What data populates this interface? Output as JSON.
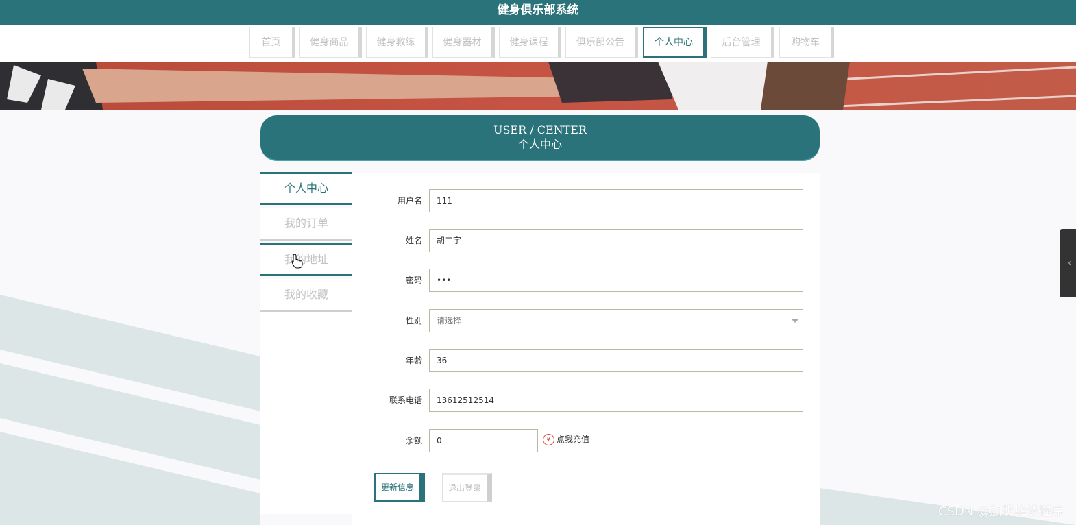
{
  "app": {
    "title": "健身俱乐部系统"
  },
  "nav": {
    "items": [
      "首页",
      "健身商品",
      "健身教练",
      "健身器材",
      "健身课程",
      "俱乐部公告",
      "个人中心",
      "后台管理",
      "购物车"
    ],
    "active_index": 6
  },
  "header": {
    "en": "USER / CENTER",
    "cn": "个人中心"
  },
  "sidebar": {
    "items": [
      "个人中心",
      "我的订单",
      "我的地址",
      "我的收藏"
    ],
    "active_index": 0
  },
  "form": {
    "username": {
      "label": "用户名",
      "value": "111"
    },
    "name": {
      "label": "姓名",
      "value": "胡二宇"
    },
    "password": {
      "label": "密码",
      "value": "•••"
    },
    "gender": {
      "label": "性别",
      "placeholder": "请选择"
    },
    "age": {
      "label": "年龄",
      "value": "36"
    },
    "phone": {
      "label": "联系电话",
      "value": "13612512514"
    },
    "balance": {
      "label": "余额",
      "value": "0",
      "recharge": "点我充值",
      "currency_icon": "¥"
    }
  },
  "buttons": {
    "update": "更新信息",
    "logout": "退出登录"
  },
  "icons": {
    "currency": "yen-icon",
    "cursor": "hand-cursor-icon",
    "tab": "chevron-left-icon"
  },
  "watermark": "CSDN @加明毕设程序",
  "colors": {
    "primary": "#2b737a",
    "background": "#f9f8fb",
    "stripe": "#dce6e7"
  }
}
